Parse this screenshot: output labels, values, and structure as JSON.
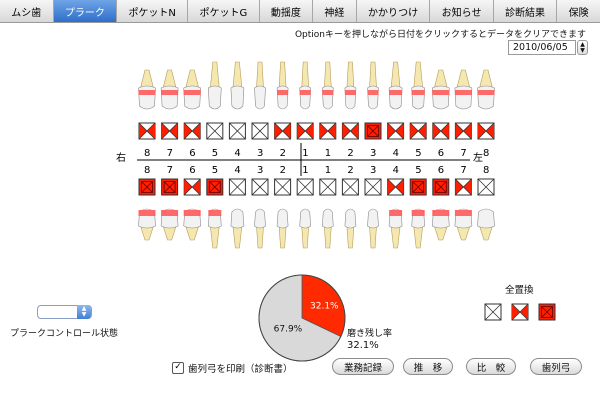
{
  "tabs": [
    {
      "label": "ムシ歯",
      "active": false
    },
    {
      "label": "プラーク",
      "active": true
    },
    {
      "label": "ポケットN",
      "active": false
    },
    {
      "label": "ポケットG",
      "active": false
    },
    {
      "label": "動揺度",
      "active": false
    },
    {
      "label": "神経",
      "active": false
    },
    {
      "label": "かかりつけ",
      "active": false
    },
    {
      "label": "お知らせ",
      "active": false
    },
    {
      "label": "診断結果",
      "active": false
    },
    {
      "label": "保険",
      "active": false
    }
  ],
  "hint": "Optionキーを押しながら日付をクリックするとデータをクリアできます",
  "date": "2010/06/05",
  "chart": {
    "right_label": "右",
    "left_label": "左",
    "upper_numbers": [
      "8",
      "7",
      "6",
      "5",
      "4",
      "3",
      "2",
      "1",
      "1",
      "2",
      "3",
      "4",
      "5",
      "6",
      "7",
      "8"
    ],
    "lower_numbers": [
      "8",
      "7",
      "6",
      "5",
      "4",
      "3",
      "2",
      "1",
      "1",
      "2",
      "3",
      "4",
      "5",
      "6",
      "7",
      "8"
    ],
    "upper_status": [
      "half",
      "half",
      "half",
      "none",
      "none",
      "none",
      "half",
      "half",
      "half",
      "half",
      "full",
      "half",
      "half",
      "half",
      "half",
      "half"
    ],
    "lower_status": [
      "full",
      "full",
      "half",
      "full",
      "none",
      "none",
      "none",
      "none",
      "none",
      "none",
      "none",
      "half",
      "full",
      "full",
      "half",
      "none"
    ],
    "upper_plaque": [
      1,
      1,
      1,
      0,
      0,
      0,
      1,
      1,
      1,
      1,
      1,
      1,
      1,
      1,
      1,
      1
    ],
    "lower_plaque": [
      1,
      1,
      1,
      1,
      0,
      0,
      0,
      0,
      0,
      0,
      0,
      1,
      1,
      1,
      1,
      0
    ]
  },
  "chart_data": {
    "type": "pie",
    "values": [
      32.1,
      67.9
    ],
    "labels": [
      "32.1%",
      "67.9%"
    ],
    "colors": [
      "#ff2a00",
      "#d9d9d9"
    ]
  },
  "pct_label": "磨き残し率",
  "pct_value": "32.1%",
  "plaque_control_label": "プラークコントロール状態",
  "zenchi_label": "全置換",
  "zenchi_options": [
    "none",
    "half",
    "full"
  ],
  "print_label": "歯列弓を印刷（診断書）",
  "print_checked": "✓",
  "buttons": [
    "業務記録",
    "推　移",
    "比　較",
    "歯列弓"
  ]
}
